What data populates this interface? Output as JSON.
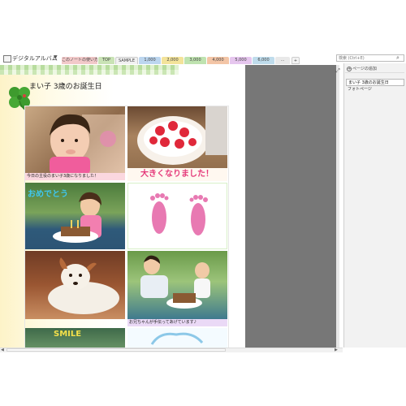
{
  "notebook": {
    "title": "デジタルアルバム"
  },
  "tabs": [
    {
      "label": "このノートの使い方",
      "color": "#f2c9c9"
    },
    {
      "label": "TOP",
      "color": "#c9e3b5"
    },
    {
      "label": "SAMPLE",
      "color": "#f1f1f1"
    },
    {
      "label": "1,000",
      "color": "#bcd6ef"
    },
    {
      "label": "2,000",
      "color": "#f3e39a"
    },
    {
      "label": "3,000",
      "color": "#bfe3b0"
    },
    {
      "label": "4,000",
      "color": "#f3c5a6"
    },
    {
      "label": "5,000",
      "color": "#e6c6ee"
    },
    {
      "label": "6,000",
      "color": "#bfdcec"
    },
    {
      "label": "...",
      "color": "#e9e9e9"
    },
    {
      "label": "+",
      "color": "#f4f4f4"
    }
  ],
  "search": {
    "placeholder": "検索 (Ctrl+E)"
  },
  "page": {
    "title": "まい子 3歳のお誕生日",
    "captions": {
      "first": "今日の主役のまい子3歳になりました！",
      "fourth": "お兄ちゃんが手伝ってあげています♪"
    },
    "handwriting": {
      "big": "大きくなりました！",
      "congrats": "おめでとう",
      "smile": "SMILE"
    }
  },
  "sidebar": {
    "add_page": "ページの追加",
    "pages": [
      {
        "label": "まい子 3歳のお誕生日",
        "selected": true
      },
      {
        "label": "フォトページ",
        "selected": false
      }
    ]
  },
  "colors": {
    "accent_green": "#b7dc9e",
    "caption_pink": "#fbd7df",
    "caption_purple": "#e6d5f5",
    "caption_blue": "#cfe6f7",
    "gray_area": "#777777"
  }
}
